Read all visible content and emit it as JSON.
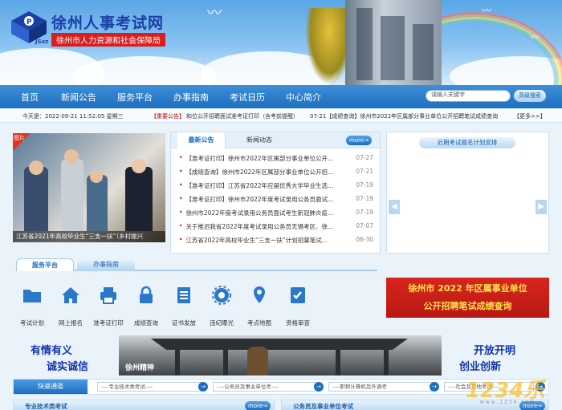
{
  "site": {
    "title": "徐州人事考试网",
    "subtitle": "徐州市人力资源和社会保障局",
    "logo_letters": "JSxz"
  },
  "nav": {
    "items": [
      "首页",
      "新闻公告",
      "服务平台",
      "办事指南",
      "考试日历",
      "中心简介"
    ],
    "search_placeholder": "请输入关键字",
    "search_button": "高级搜索"
  },
  "infobar": {
    "date": "今天是：2022-09-21 11:52:05 星期三",
    "notice_tag": "【重要公告】",
    "notice_text": "和位公开招聘面试准考证打印（含考前提醒）",
    "ticker": "07-21【成绩查询】徐州市2022年区属部分事业单位公开招聘笔试成绩查询",
    "more": "【更多>>】"
  },
  "photo": {
    "tag": "图片",
    "caption": "江苏省2021年高校毕业生“三支一扶”（乡村振兴"
  },
  "news": {
    "tabs": [
      "最新公告",
      "新闻动态"
    ],
    "more": "more→",
    "items": [
      {
        "text": "【准考证打印】徐州市2022年区属部分事业单位公开...",
        "date": "07-27"
      },
      {
        "text": "【成绩查询】徐州市2022年区属部分事业单位公开招...",
        "date": "07-21"
      },
      {
        "text": "【准考证打印】江苏省2022年应届优秀大学毕业生选...",
        "date": "07-19"
      },
      {
        "text": "【准考证打印】徐州市2022年度考试录用公务员面试...",
        "date": "07-19"
      },
      {
        "text": "徐州市2022年度考试录用公务员面试考生新冠肺炎疫...",
        "date": "07-19"
      },
      {
        "text": "关于推迟我省2022年度考试录用公务员无锡考区、徐...",
        "date": "07-07"
      },
      {
        "text": "江苏省2022年高校毕业生“三支一扶”计划招募笔试...",
        "date": "06-30"
      }
    ]
  },
  "rpanel": {
    "title": "近期考试报名计划安排",
    "prev": "◀",
    "next": "▶"
  },
  "service": {
    "tabs": [
      "服务平台",
      "办事指南"
    ],
    "items": [
      "考试计划",
      "网上报名",
      "准考证打印",
      "成绩查询",
      "证书发放",
      "违纪曝光",
      "考点地图",
      "资格审查"
    ]
  },
  "ad": {
    "line1": "徐州市 2022 年区属事业单位",
    "line2": "公开招聘笔试成绩查询"
  },
  "slogans": {
    "left1": "有情有义",
    "left2": "诚实诚信",
    "right1": "开放开明",
    "right2": "创业创新",
    "gate_label": "徐州精神"
  },
  "quick": {
    "title": "快速通道",
    "selects": [
      "----专业技术类考试----",
      "----公务员及事业单位考----",
      "----职称计算机及外语考",
      "----社会及其他考试----"
    ],
    "go": "→"
  },
  "bottom": {
    "left_title": "专业技术类考试",
    "right_title": "公务员及事业单位考试",
    "more": "more→"
  },
  "watermark": {
    "main": "1234乐",
    "sub": "w w w . 1 2 3 4 . c o m"
  }
}
